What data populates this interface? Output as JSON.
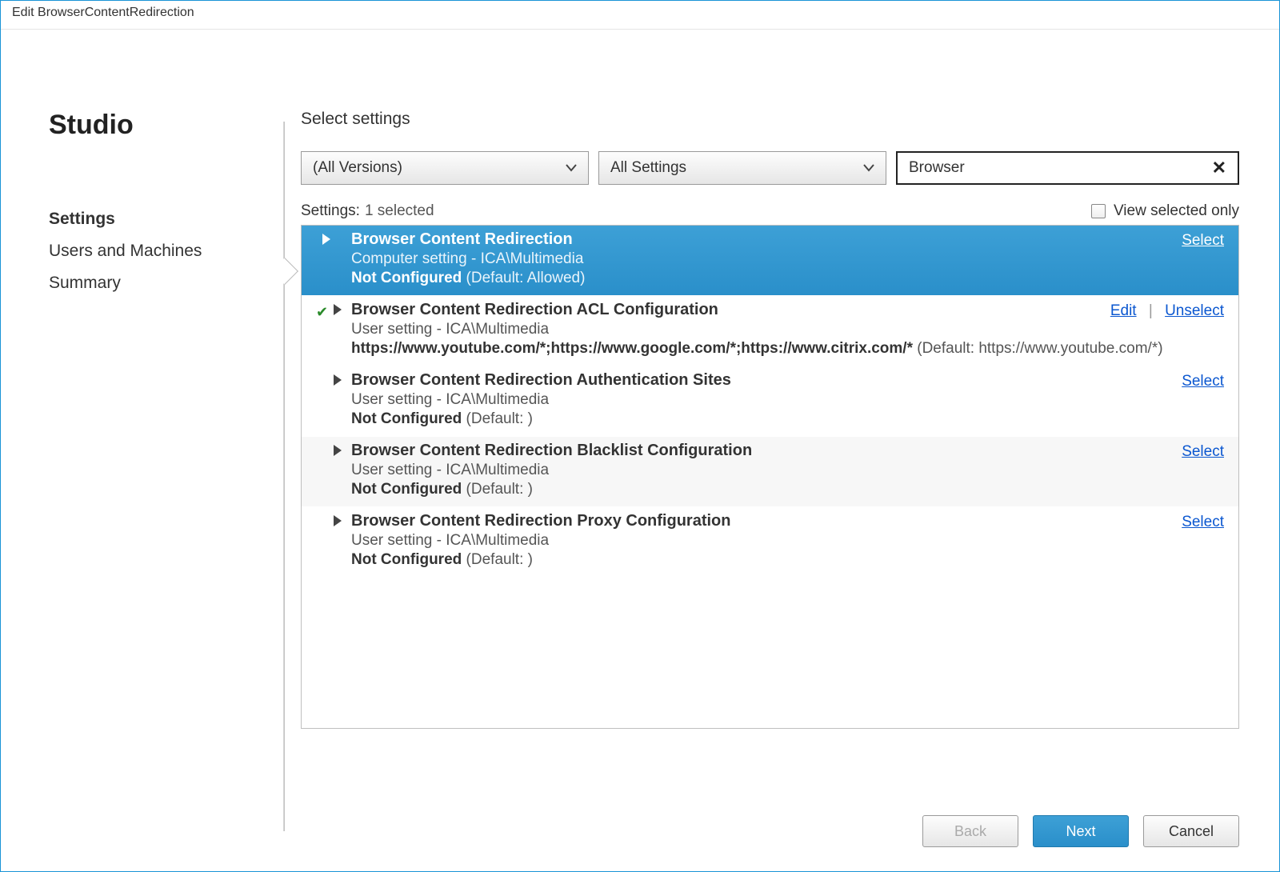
{
  "window": {
    "title": "Edit BrowserContentRedirection"
  },
  "sidebar": {
    "brand": "Studio",
    "items": [
      {
        "label": "Settings",
        "active": true
      },
      {
        "label": "Users and Machines",
        "active": false
      },
      {
        "label": "Summary",
        "active": false
      }
    ]
  },
  "main": {
    "section_label": "Select settings",
    "filter": {
      "versions": "(All Versions)",
      "settings_scope": "All Settings",
      "search": "Browser"
    },
    "status": {
      "label": "Settings:",
      "count": "1 selected"
    },
    "view_selected_only": {
      "label": "View selected only",
      "checked": false
    },
    "rows": [
      {
        "title": "Browser Content Redirection",
        "scope": "Computer setting - ICA\\Multimedia",
        "state": "Not Configured",
        "default": "(Default: Allowed)",
        "selected": true,
        "checked": false,
        "actions": {
          "primary": "Select"
        }
      },
      {
        "title": "Browser Content Redirection ACL Configuration",
        "scope": "User setting - ICA\\Multimedia",
        "value_strong": "https://www.youtube.com/*;https://www.google.com/*;https://www.citrix.com/*",
        "value_paren": " (Default: https://www.youtube.com/*)",
        "selected": false,
        "checked": true,
        "actions": {
          "edit": "Edit",
          "unselect": "Unselect"
        }
      },
      {
        "title": "Browser Content Redirection Authentication Sites",
        "scope": "User setting - ICA\\Multimedia",
        "state": "Not Configured",
        "default": "(Default: )",
        "selected": false,
        "checked": false,
        "actions": {
          "primary": "Select"
        }
      },
      {
        "title": "Browser Content Redirection Blacklist Configuration",
        "scope": "User setting - ICA\\Multimedia",
        "state": "Not Configured",
        "default": "(Default: )",
        "selected": false,
        "checked": false,
        "actions": {
          "primary": "Select"
        }
      },
      {
        "title": "Browser Content Redirection Proxy Configuration",
        "scope": "User setting - ICA\\Multimedia",
        "state": "Not Configured",
        "default": "(Default: )",
        "selected": false,
        "checked": false,
        "actions": {
          "primary": "Select"
        }
      }
    ]
  },
  "footer": {
    "back": "Back",
    "next": "Next",
    "cancel": "Cancel"
  }
}
